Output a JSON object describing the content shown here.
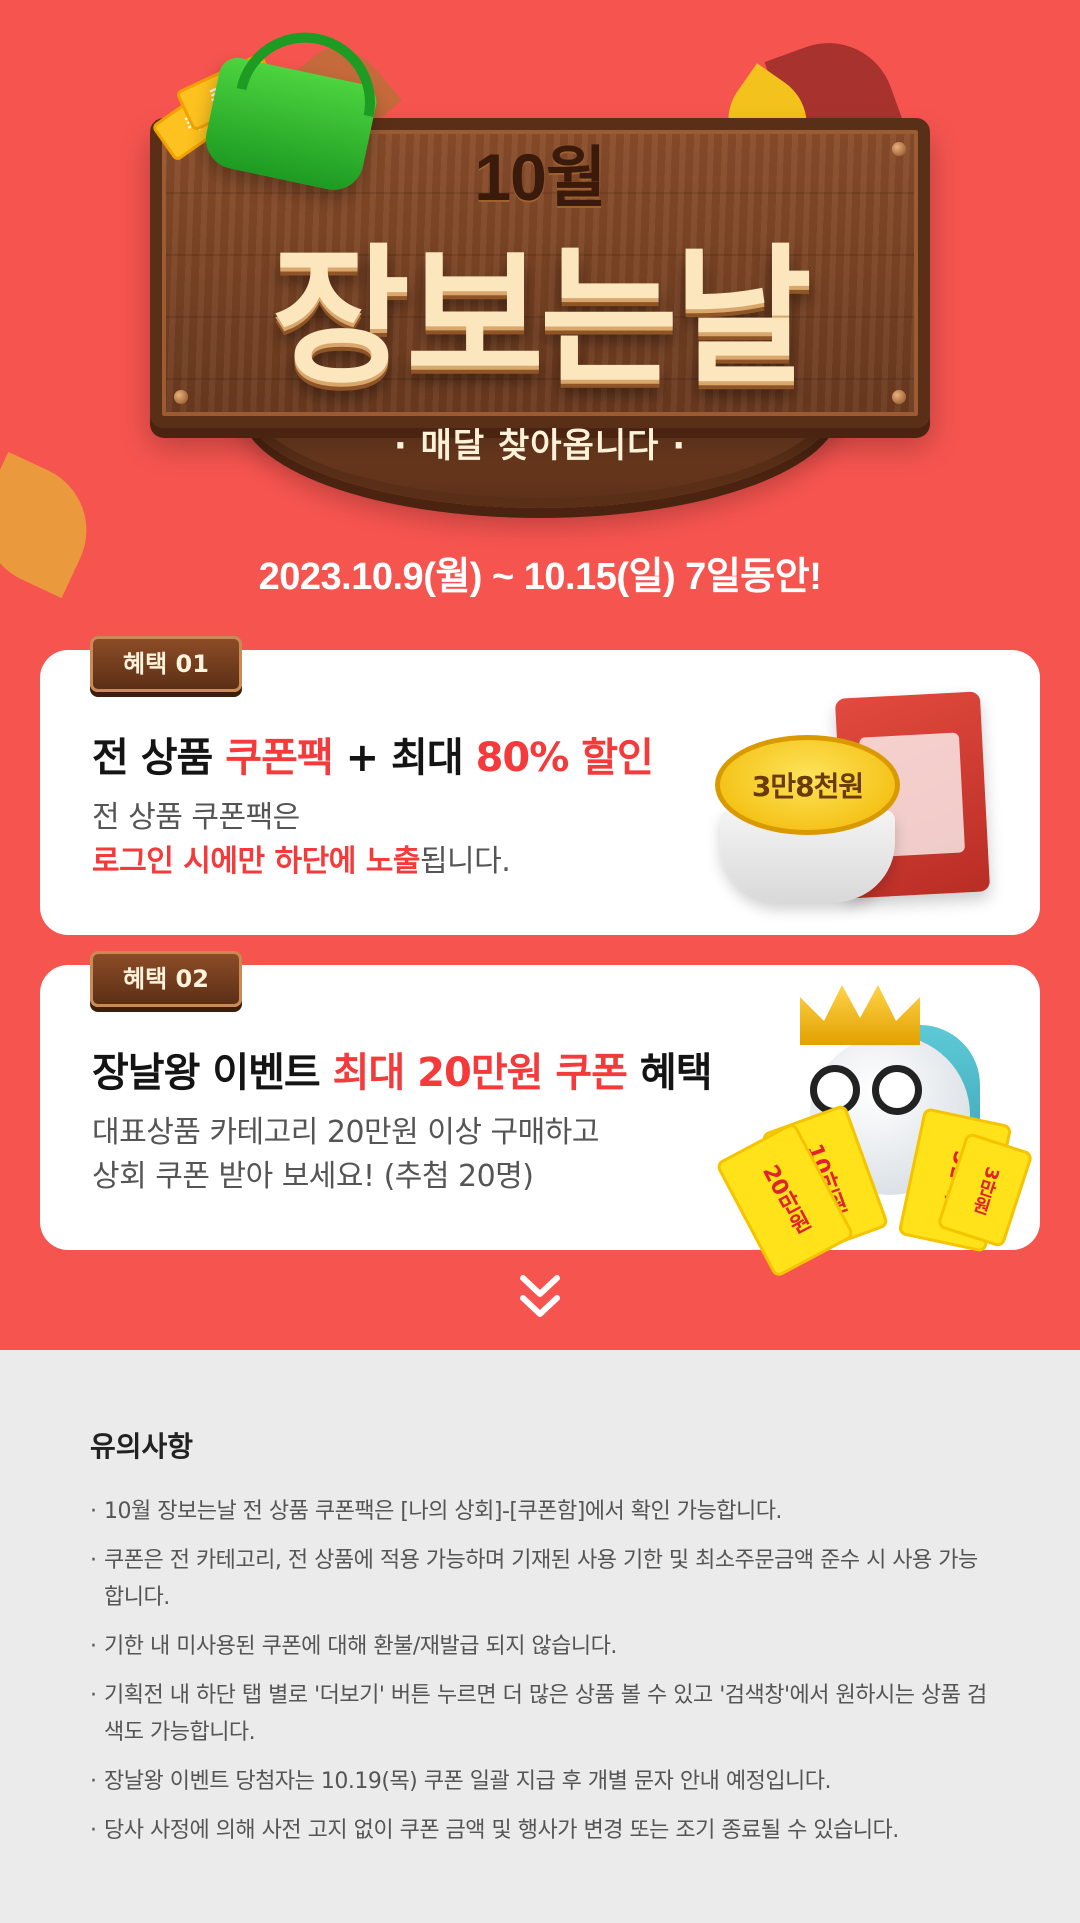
{
  "hero": {
    "month": "10월",
    "title": "장보는날",
    "subtitle": "· 매달 찾아옵니다 ·",
    "coupon_tag": "쿠폰",
    "date_range": "2023.10.9(월) ~ 10.15(일) 7일동안!",
    "colors": {
      "background": "#f6544f",
      "accent": "#f43a3a"
    }
  },
  "benefits": [
    {
      "badge": "혜택 01",
      "title_a": "전 상품 ",
      "title_b": "쿠폰팩",
      "title_c": " + 최대 ",
      "title_d": "80% 할인",
      "desc_line1": "전 상품 쿠폰팩은",
      "desc_line2_hl": "로그인 시에만 하단에 노출",
      "desc_line2_rest": "됩니다.",
      "image_price": "3만8천원"
    },
    {
      "badge": "혜택 02",
      "title_a": "장날왕 이벤트 ",
      "title_b": "최대 20만원 쿠폰",
      "title_c": " 혜택",
      "desc_line1": "대표상품 카테고리 20만원 이상 구매하고",
      "desc_line2": "상회 쿠폰 받아 보세요! (추첨 20명)",
      "coupon_labels": [
        "10만원",
        "20만원",
        "5만원",
        "3만원"
      ]
    }
  ],
  "notice": {
    "title": "유의사항",
    "items": [
      "10월 장보는날 전 상품 쿠폰팩은 [나의 상회]-[쿠폰함]에서 확인 가능합니다.",
      "쿠폰은 전 카테고리, 전 상품에 적용 가능하며 기재된 사용 기한 및 최소주문금액 준수 시 사용 가능합니다.",
      "기한 내 미사용된 쿠폰에 대해 환불/재발급 되지 않습니다.",
      "기획전 내 하단 탭 별로 '더보기' 버튼 누르면 더 많은 상품 볼 수 있고 '검색창'에서 원하시는 상품 검색도 가능합니다.",
      "장날왕 이벤트 당첨자는 10.19(목) 쿠폰 일괄 지급 후 개별 문자 안내 예정입니다.",
      "당사 사정에 의해 사전 고지 없이 쿠폰 금액 및 행사가 변경 또는 조기 종료될 수 있습니다."
    ]
  },
  "icons": {
    "scroll_down": "double-chevron-down-icon"
  }
}
